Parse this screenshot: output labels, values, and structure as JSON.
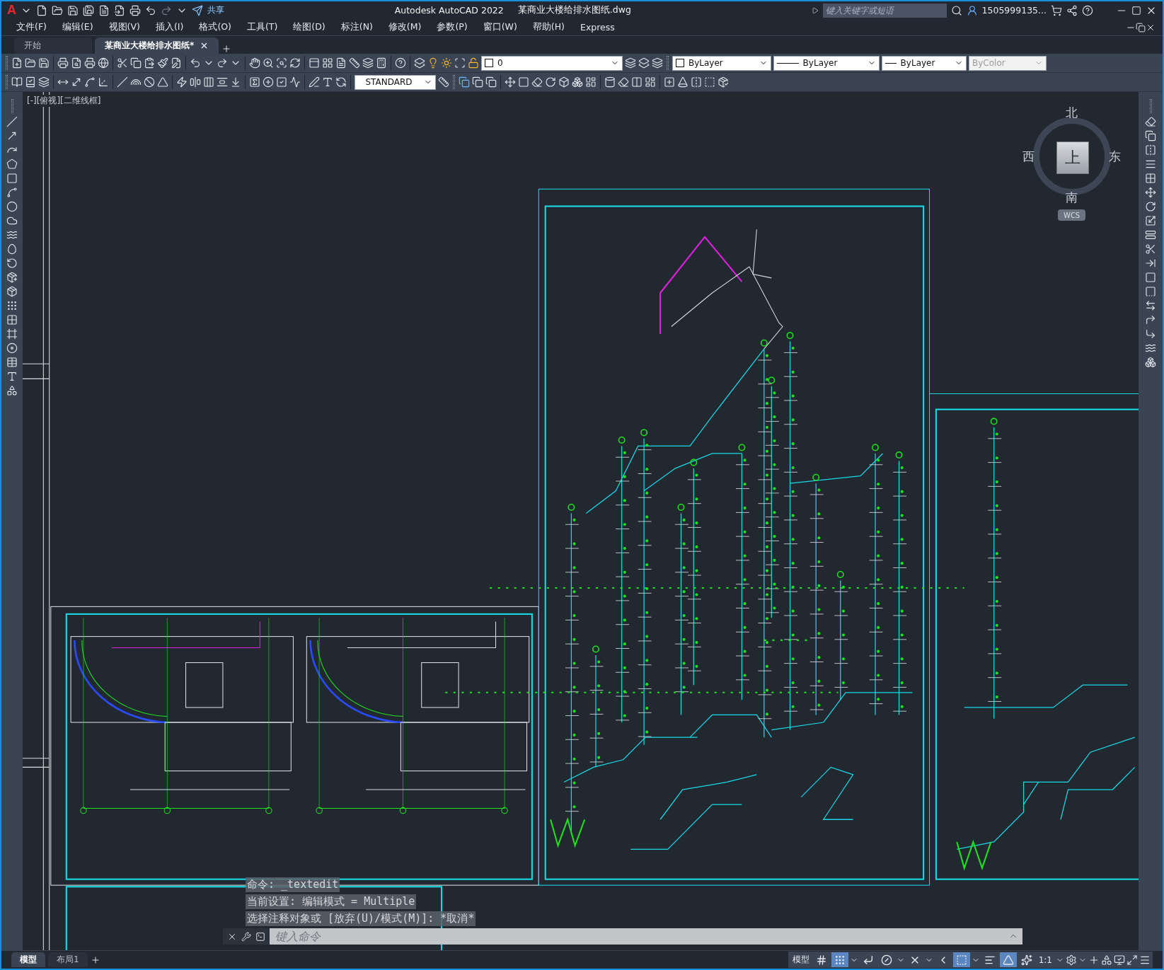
{
  "title_bar": {
    "logo": "A",
    "share_label": "共享",
    "title": "Autodesk AutoCAD 2022",
    "file_name": "某商业大楼给排水图纸.dwg",
    "search": {
      "placeholder": "键入关键字或短语"
    },
    "user": "1505999135..."
  },
  "menu": [
    "文件(F)",
    "编辑(E)",
    "视图(V)",
    "插入(I)",
    "格式(O)",
    "工具(T)",
    "绘图(D)",
    "标注(N)",
    "修改(M)",
    "参数(P)",
    "窗口(W)",
    "帮助(H)",
    "Express"
  ],
  "document_tabs": [
    {
      "label": "开始",
      "selected": false
    },
    {
      "label": "某商业大楼给排水图纸*",
      "selected": true
    }
  ],
  "layer_control": {
    "layer": "0"
  },
  "text_style": "STANDARD",
  "properties": [
    {
      "kind": "color",
      "value": "ByLayer",
      "disabled": false
    },
    {
      "kind": "linetype",
      "value": "ByLayer",
      "disabled": false
    },
    {
      "kind": "lineweight",
      "value": "ByLayer",
      "disabled": false
    },
    {
      "kind": "plotstyle",
      "value": "ByColor",
      "disabled": true
    }
  ],
  "viewport_label": "[-][俯视][二维线框]",
  "viewcube": {
    "north": "北",
    "south": "南",
    "west": "西",
    "east": "东",
    "face": "上",
    "ucs": "WCS"
  },
  "command_history": [
    "命令: _textedit",
    "当前设置: 编辑模式 = Multiple",
    "选择注释对象或 [放弃(U)/模式(M)]: *取消*"
  ],
  "command_input": {
    "placeholder": "键入命令"
  },
  "layout_tabs": [
    {
      "label": "模型",
      "selected": true
    },
    {
      "label": "布局1",
      "selected": false
    }
  ],
  "status_bar": {
    "space": "模型",
    "scale": "1:1",
    "toggles": [
      {
        "kind": "grid",
        "on": false
      },
      {
        "kind": "snap",
        "on": true
      },
      {
        "kind": "ortho",
        "on": false
      },
      {
        "kind": "polar",
        "on": false
      },
      {
        "kind": "isodraft",
        "on": false
      },
      {
        "kind": "osnap_tracking",
        "on": false
      },
      {
        "kind": "selection_cycling",
        "on": true
      },
      {
        "kind": "lineweight",
        "on": false
      },
      {
        "kind": "annotation_visibility",
        "on": true
      },
      {
        "kind": "autoscale",
        "on": false
      }
    ]
  }
}
